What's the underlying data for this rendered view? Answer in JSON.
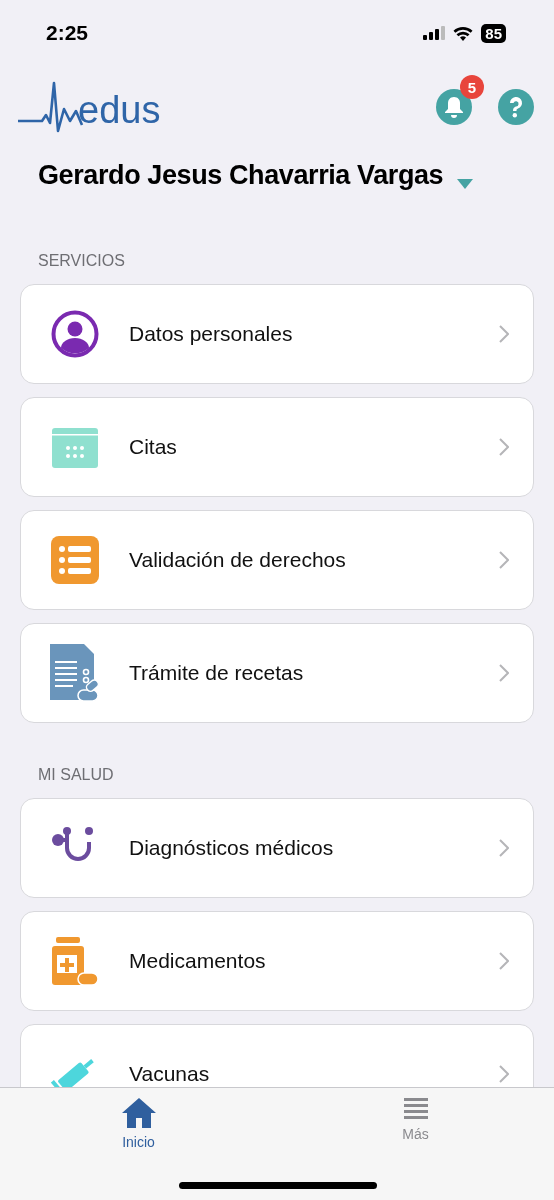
{
  "status_bar": {
    "time": "2:25",
    "battery": "85"
  },
  "header": {
    "logo_text": "edus",
    "notifications_badge": "5"
  },
  "user": {
    "name": "Gerardo Jesus Chavarria Vargas"
  },
  "sections": [
    {
      "title": "SERVICIOS",
      "items": [
        {
          "kind": "person",
          "label": "Datos personales"
        },
        {
          "kind": "calendar",
          "label": "Citas"
        },
        {
          "kind": "list",
          "label": "Validación de derechos"
        },
        {
          "kind": "prescription",
          "label": "Trámite de recetas"
        }
      ]
    },
    {
      "title": "MI SALUD",
      "items": [
        {
          "kind": "stethoscope",
          "label": "Diagnósticos médicos"
        },
        {
          "kind": "medicine",
          "label": "Medicamentos"
        },
        {
          "kind": "syringe",
          "label": "Vacunas"
        }
      ]
    }
  ],
  "tab_bar": [
    {
      "kind": "home",
      "label": "Inicio",
      "selected": true
    },
    {
      "kind": "more",
      "label": "Más",
      "selected": false
    }
  ]
}
